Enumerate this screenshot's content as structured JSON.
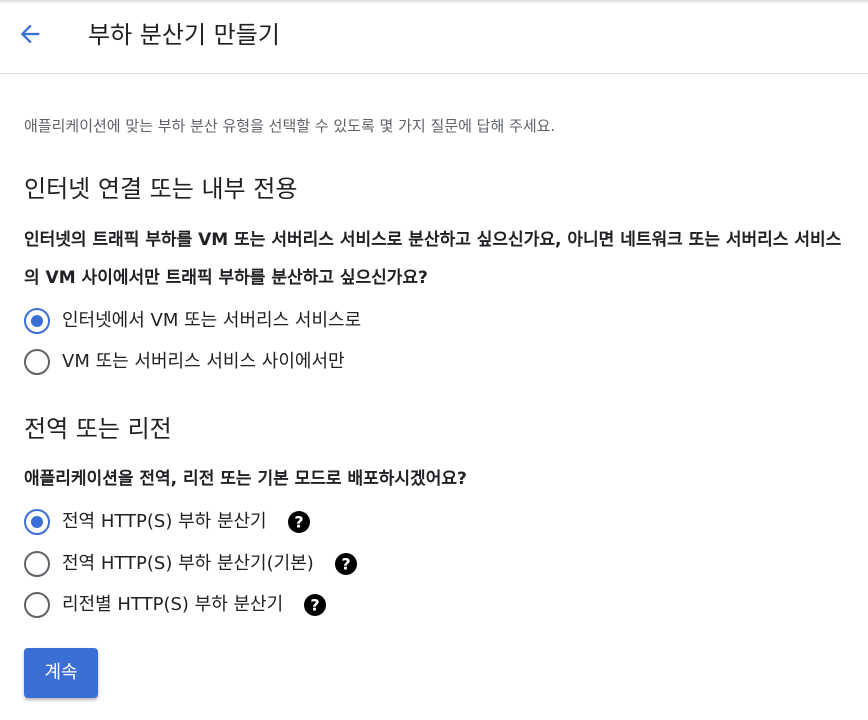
{
  "header": {
    "back_icon": "arrow-left-icon",
    "title": "부하 분산기 만들기"
  },
  "intro": "애플리케이션에 맞는 부하 분산 유형을 선택할 수 있도록 몇 가지 질문에 답해 주세요.",
  "section1": {
    "title": "인터넷 연결 또는 내부 전용",
    "question": "인터넷의 트래픽 부하를 VM 또는 서버리스 서비스로 분산하고 싶으신가요, 아니면 네트워크 또는 서버리스 서비스의 VM 사이에서만 트래픽 부하를 분산하고 싶으신가요?",
    "options": [
      {
        "label": "인터넷에서 VM 또는 서버리스 서비스로",
        "selected": true
      },
      {
        "label": "VM 또는 서버리스 서비스 사이에서만",
        "selected": false
      }
    ]
  },
  "section2": {
    "title": "전역 또는 리전",
    "question": "애플리케이션을 전역, 리전 또는 기본 모드로 배포하시겠어요?",
    "options": [
      {
        "label": "전역 HTTP(S) 부하 분산기",
        "selected": true,
        "help_icon": "help-icon"
      },
      {
        "label": "전역 HTTP(S) 부하 분산기(기본)",
        "selected": false,
        "help_icon": "help-icon"
      },
      {
        "label": "리전별 HTTP(S) 부하 분산기",
        "selected": false,
        "help_icon": "help-icon"
      }
    ]
  },
  "actions": {
    "continue_label": "계속"
  },
  "colors": {
    "accent": "#3b6fd4",
    "text": "#202124",
    "muted": "#5f6368"
  }
}
